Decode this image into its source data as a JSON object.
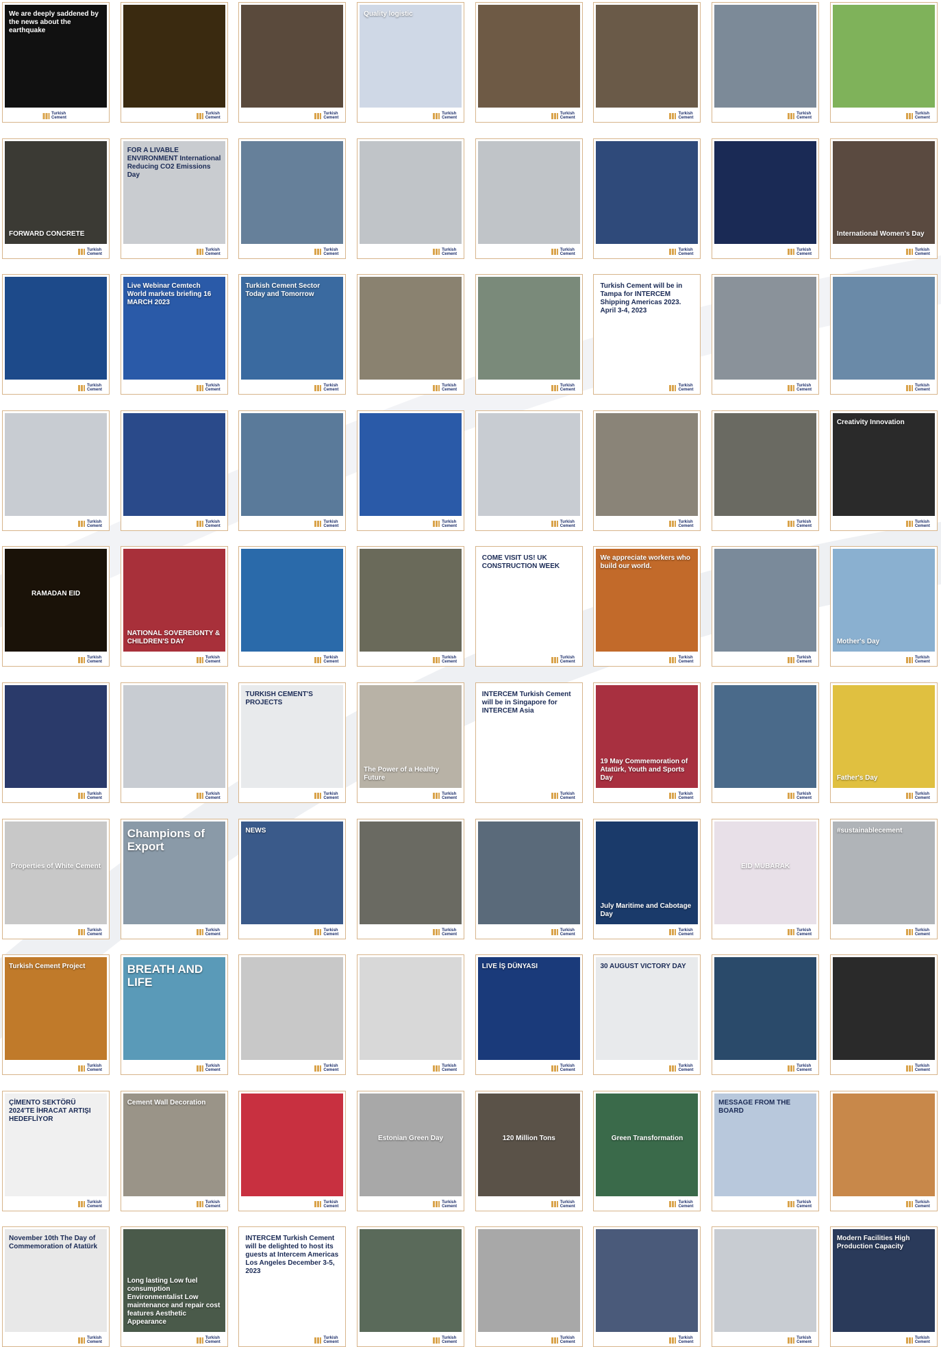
{
  "brand": {
    "logo_text": "Turkish Cement",
    "accent": "#d9a34b",
    "border": "#d7b48a"
  },
  "cards": [
    {
      "title": "We are deeply saddened by the news about the earthquake",
      "bg": "#111111",
      "t": "sm",
      "icon": "earthquake-message"
    },
    {
      "title": "",
      "bg": "#3a2a10",
      "icon": "plant-night-photo"
    },
    {
      "title": "",
      "bg": "#5a4a3c",
      "icon": "conference-photo"
    },
    {
      "title": "Quality logistic",
      "bg": "#cfd8e6",
      "icon": "world-map-graphic"
    },
    {
      "title": "",
      "bg": "#6e5a45",
      "icon": "group-photo"
    },
    {
      "title": "",
      "bg": "#6a5a48",
      "icon": "podium-photo"
    },
    {
      "title": "",
      "bg": "#7c8a98",
      "icon": "plant-photo"
    },
    {
      "title": "",
      "bg": "#7fb25a",
      "icon": "leaf-hand-photo"
    },
    {
      "title": "FORWARD CONCRETE",
      "bg": "#3b3a34",
      "t": "bot",
      "icon": "group-photo"
    },
    {
      "title": "FOR A LIVABLE ENVIRONMENT International Reducing CO2 Emissions Day",
      "bg": "#c9ccd0",
      "t": "dark",
      "icon": "plant-pot-photo"
    },
    {
      "title": "",
      "bg": "#66809a",
      "icon": "plant-photo"
    },
    {
      "title": "",
      "bg": "#c0c4c8",
      "icon": "people-photo"
    },
    {
      "title": "",
      "bg": "#c0c4c8",
      "icon": "people-photo"
    },
    {
      "title": "",
      "bg": "#2f4a7a",
      "icon": "panel-photo"
    },
    {
      "title": "",
      "bg": "#1a2a55",
      "icon": "plant-night-photo"
    },
    {
      "title": "International Women's Day",
      "bg": "#5a4a40",
      "t": "bot",
      "icon": "lab-photo"
    },
    {
      "title": "",
      "bg": "#1d4a8a",
      "icon": "booth-photo"
    },
    {
      "title": "Live Webinar Cemtech World markets briefing 16 MARCH 2023",
      "bg": "#2a5aa8",
      "t": "sm",
      "icon": "webinar-graphic"
    },
    {
      "title": "Turkish Cement Sector Today and Tomorrow",
      "bg": "#3a6aa0",
      "t": "sm",
      "icon": "webinar-graphic"
    },
    {
      "title": "",
      "bg": "#8a8270",
      "icon": "concrete-furniture-photo"
    },
    {
      "title": "",
      "bg": "#7a8a7a",
      "icon": "plant-photo"
    },
    {
      "title": "Turkish Cement will be in Tampa for INTERCEM Shipping Americas 2023. April 3-4, 2023",
      "bg": "#ffffff",
      "t": "dark",
      "icon": "event-graphic"
    },
    {
      "title": "",
      "bg": "#8a929a",
      "icon": "plant-photo"
    },
    {
      "title": "",
      "bg": "#6a8aa8",
      "icon": "plant-photo"
    },
    {
      "title": "",
      "bg": "#c8ccd2",
      "icon": "booth-photo"
    },
    {
      "title": "",
      "bg": "#2a4a8a",
      "icon": "panel-photo"
    },
    {
      "title": "",
      "bg": "#5a7a9a",
      "icon": "collage-photo"
    },
    {
      "title": "",
      "bg": "#2a5aa8",
      "icon": "booth-photo"
    },
    {
      "title": "",
      "bg": "#c8ccd2",
      "icon": "booth-photo"
    },
    {
      "title": "",
      "bg": "#8a8478",
      "icon": "plant-photo"
    },
    {
      "title": "",
      "bg": "#6a6a62",
      "icon": "workers-photo"
    },
    {
      "title": "Creativity Innovation",
      "bg": "#2a2a2a",
      "t": "sm",
      "icon": "lightbulb-graphic"
    },
    {
      "title": "RAMADAN EID",
      "bg": "#1a1208",
      "t": "mid",
      "icon": "holiday-graphic"
    },
    {
      "title": "NATIONAL SOVEREIGNTY & CHILDREN'S DAY",
      "bg": "#a8303a",
      "t": "bot",
      "icon": "holiday-graphic"
    },
    {
      "title": "",
      "bg": "#2a6aaa",
      "icon": "world-map-graphic"
    },
    {
      "title": "",
      "bg": "#6a6a5a",
      "icon": "concrete-furniture-photo"
    },
    {
      "title": "COME VISIT US! UK CONSTRUCTION WEEK",
      "bg": "#ffffff",
      "t": "dark",
      "icon": "event-graphic"
    },
    {
      "title": "We appreciate workers who build our world.",
      "bg": "#c26a2a",
      "t": "sm",
      "icon": "worker-silhouette-graphic"
    },
    {
      "title": "",
      "bg": "#7a8a9a",
      "icon": "group-photo"
    },
    {
      "title": "Mother's Day",
      "bg": "#8ab0d0",
      "t": "bot",
      "icon": "holiday-graphic"
    },
    {
      "title": "",
      "bg": "#2a3a6a",
      "icon": "speaker-photo"
    },
    {
      "title": "",
      "bg": "#c8ccd2",
      "icon": "stage-photo"
    },
    {
      "title": "TURKISH CEMENT'S PROJECTS",
      "bg": "#e8eaec",
      "t": "dark",
      "icon": "infographic"
    },
    {
      "title": "The Power of a Healthy Future",
      "bg": "#b8b2a6",
      "t": "bot",
      "icon": "handprint-graphic"
    },
    {
      "title": "INTERCEM Turkish Cement will be in Singapore for INTERCEM Asia",
      "bg": "#ffffff",
      "t": "dark",
      "icon": "event-graphic"
    },
    {
      "title": "19 May Commemoration of Atatürk, Youth and Sports Day",
      "bg": "#a83040",
      "t": "bot",
      "icon": "holiday-graphic"
    },
    {
      "title": "",
      "bg": "#4a6a8a",
      "icon": "pier-photo"
    },
    {
      "title": "Father's Day",
      "bg": "#e0c040",
      "t": "bot",
      "icon": "holiday-graphic"
    },
    {
      "title": "Properties of White Cement",
      "bg": "#c8c8c8",
      "t": "mid",
      "icon": "cement-graphic"
    },
    {
      "title": "Champions of Export",
      "bg": "#8a9aa8",
      "t": "big",
      "icon": "export-graphic"
    },
    {
      "title": "NEWS",
      "bg": "#3a5a8a",
      "icon": "stadium-photo"
    },
    {
      "title": "",
      "bg": "#6a6a62",
      "icon": "concrete-bench-photo"
    },
    {
      "title": "",
      "bg": "#5a6a7a",
      "icon": "booth-photo"
    },
    {
      "title": "July Maritime and Cabotage Day",
      "bg": "#1a3a6a",
      "t": "bot",
      "icon": "holiday-graphic"
    },
    {
      "title": "EID MUBARAK",
      "bg": "#e8e0e8",
      "t": "mid",
      "icon": "holiday-graphic"
    },
    {
      "title": "#sustainablecement",
      "bg": "#b0b4b8",
      "t": "sm",
      "icon": "green-graphic"
    },
    {
      "title": "Turkish Cement Project",
      "bg": "#c07a2a",
      "t": "sm",
      "icon": "construction-photo"
    },
    {
      "title": "BREATH AND LIFE",
      "bg": "#5a9ab8",
      "t": "big",
      "icon": "green-city-graphic"
    },
    {
      "title": "",
      "bg": "#c8c8c8",
      "icon": "plant-pot-photo"
    },
    {
      "title": "",
      "bg": "#d8d8d8",
      "icon": "speaker-photo"
    },
    {
      "title": "LIVE İŞ DÜNYASI",
      "bg": "#1a3a7a",
      "t": "sm",
      "icon": "tv-graphic"
    },
    {
      "title": "30 AUGUST VICTORY DAY",
      "bg": "#e8eaec",
      "t": "dark",
      "icon": "holiday-graphic"
    },
    {
      "title": "",
      "bg": "#2a4a6a",
      "icon": "tv-graphic"
    },
    {
      "title": "",
      "bg": "#2a2a2a",
      "icon": "press-photo"
    },
    {
      "title": "ÇİMENTO SEKTÖRÜ 2024'TE İHRACAT ARTIŞI HEDEFLİYOR",
      "bg": "#f0f0f0",
      "t": "dark",
      "icon": "newspaper-graphic"
    },
    {
      "title": "Cement Wall Decoration",
      "bg": "#9a9488",
      "t": "sm",
      "icon": "interior-photo"
    },
    {
      "title": "",
      "bg": "#c83040",
      "icon": "speaker-photo"
    },
    {
      "title": "Estonian Green Day",
      "bg": "#a8a8a8",
      "t": "mid",
      "icon": "architecture-photo"
    },
    {
      "title": "120 Million Tons",
      "bg": "#5a5248",
      "t": "mid",
      "icon": "cement-graphic"
    },
    {
      "title": "Green Transformation",
      "bg": "#3a6a4a",
      "t": "mid",
      "icon": "green-graphic"
    },
    {
      "title": "MESSAGE FROM THE BOARD",
      "bg": "#b8c8dc",
      "t": "dark",
      "icon": "message-graphic"
    },
    {
      "title": "",
      "bg": "#c8884a",
      "icon": "construction-photo"
    },
    {
      "title": "November 10th The Day of Commemoration of Atatürk",
      "bg": "#e8e8e8",
      "t": "dark",
      "icon": "holiday-graphic"
    },
    {
      "title": "Long lasting Low fuel consumption Environmentalist Low maintenance and repair cost features Aesthetic Appearance",
      "bg": "#4a5a4a",
      "t": "bot",
      "icon": "tunnel-photo"
    },
    {
      "title": "INTERCEM Turkish Cement will be delighted to host its guests at Intercem Americas Los Angeles December 3-5, 2023",
      "bg": "#ffffff",
      "t": "dark",
      "icon": "event-graphic"
    },
    {
      "title": "",
      "bg": "#5a6a5a",
      "icon": "tree-photo"
    },
    {
      "title": "",
      "bg": "#a8a8a8",
      "icon": "concrete-tool-photo"
    },
    {
      "title": "",
      "bg": "#4a5a7a",
      "icon": "group-photo"
    },
    {
      "title": "",
      "bg": "#c8ccd2",
      "icon": "group-photo"
    },
    {
      "title": "Modern Facilities High Production Capacity",
      "bg": "#2a3a5a",
      "t": "sm",
      "icon": "stadium-photo"
    }
  ]
}
